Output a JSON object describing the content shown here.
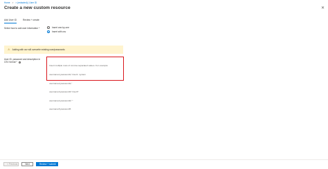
{
  "breadcrumb": {
    "items": [
      "Home",
      "> (redacted) | User ID"
    ],
    "separator": ">"
  },
  "page": {
    "title": "Create a new custom resource"
  },
  "tabs": [
    {
      "label": "Add User ID",
      "active": true
    },
    {
      "label": "Review + create",
      "active": false
    }
  ],
  "form": {
    "method_label": "Select how to add user information *",
    "radio_options": [
      {
        "label": "Insert one-by-one",
        "selected": false
      },
      {
        "label": "Insert with csv",
        "selected": true
      }
    ],
    "warning": {
      "icon": "warning-icon",
      "text": "Adding with csv will overwrite existing user/passwords"
    },
    "csv_label": "User ID, password and description in CSV format *",
    "info_icon": "i",
    "textarea_lines": [
      "Insert multiple rows of comma separated values. For example:",
      "username1,password1,\"User1: system",
      "username2,password2,\"",
      "username3,password3,\"User3\"",
      "username4,password4,\"\"",
      "username5,password5"
    ]
  },
  "footer": {
    "previous_label": "< Previous",
    "next_label": "Next",
    "submit_label": "Review + submit"
  },
  "colors": {
    "accent": "#0078d4",
    "warning_bg": "#fff4ce",
    "highlight_border": "#d9151b"
  }
}
